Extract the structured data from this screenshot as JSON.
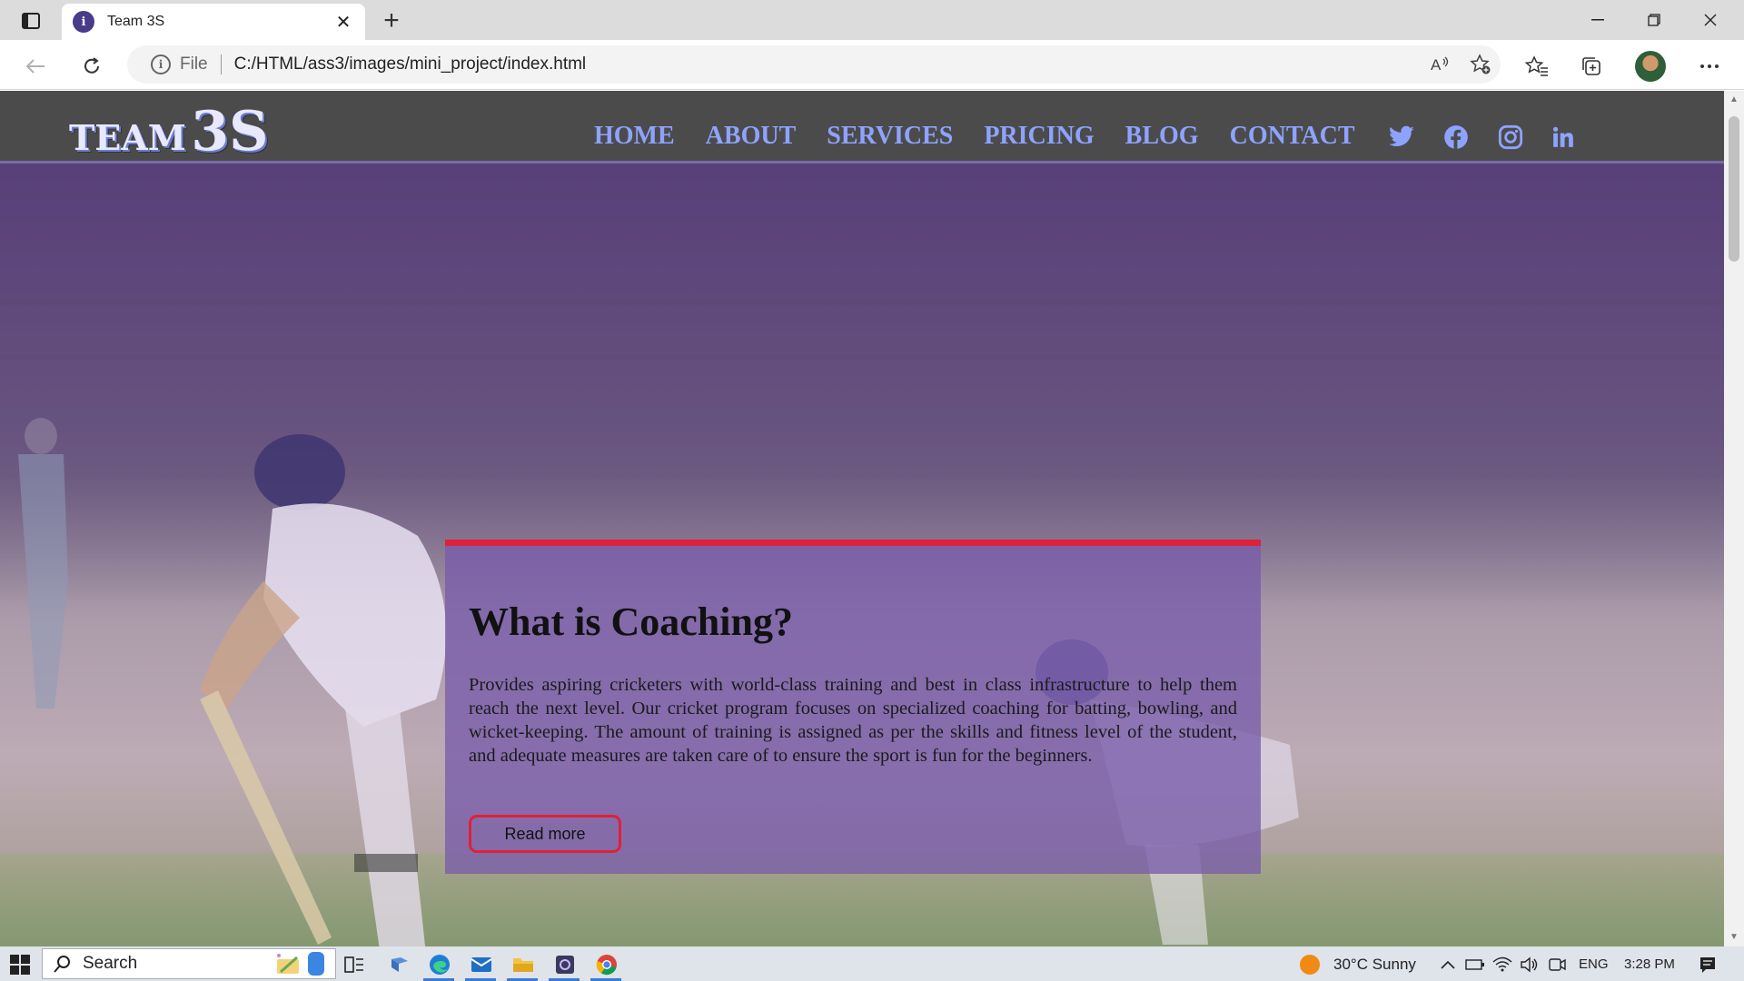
{
  "browser": {
    "tab_title": "Team 3S",
    "url_scheme_label": "File",
    "url": "C:/HTML/ass3/images/mini_project/index.html"
  },
  "site": {
    "logo_team": "TEAM",
    "logo_3s": "3S",
    "nav": [
      "HOME",
      "ABOUT",
      "SERVICES",
      "PRICING",
      "BLOG",
      "CONTACT"
    ],
    "social_icons": [
      "twitter-icon",
      "facebook-icon",
      "instagram-icon",
      "linkedin-icon"
    ],
    "accent_color": "#8ea3ff",
    "header_color": "#4b4b4b"
  },
  "card": {
    "title": "What is Coaching?",
    "body": "Provides aspiring cricketers with world-class training and best in class infrastructure to help them reach the next level. Our cricket program focuses on specialized coaching for batting, bowling, and wicket-keeping. The amount of training is assigned as per the skills and fitness level of the student, and adequate measures are taken care of to ensure the sport is fun for the beginners.",
    "button_label": "Read more",
    "border_color": "#e0203a"
  },
  "taskbar": {
    "search_label": "Search",
    "weather": "30°C  Sunny",
    "language": "ENG",
    "time": "3:28 PM"
  }
}
